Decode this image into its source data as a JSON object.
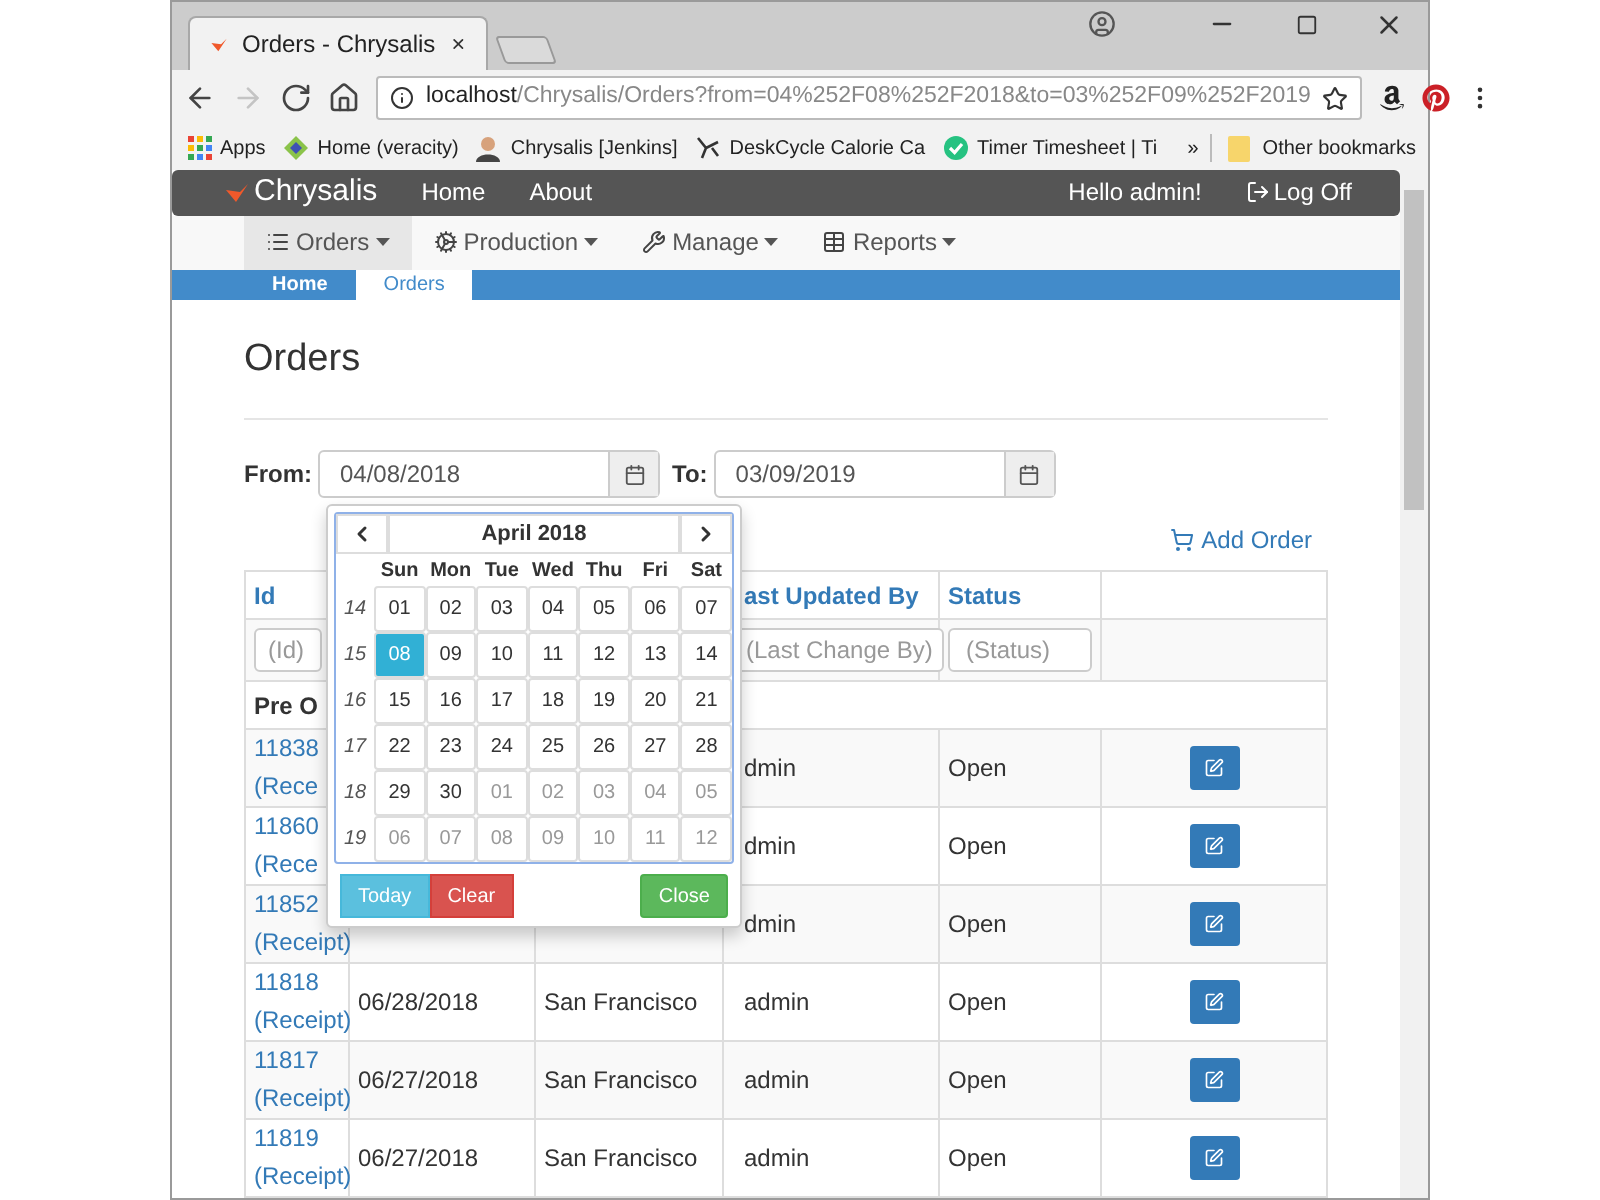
{
  "browser": {
    "tab": {
      "title": "Orders - Chrysalis"
    },
    "nav": [
      {
        "kind": "back",
        "disabled": false
      },
      {
        "kind": "forward",
        "disabled": true
      },
      {
        "kind": "reload",
        "disabled": false
      },
      {
        "kind": "home",
        "disabled": false
      }
    ],
    "url": {
      "host": "localhost",
      "path": "/Chrysalis/Orders?from=04%252F08%252F2018&to=03%252F09%252F2019"
    },
    "bookmarks": [
      {
        "kind": "apps",
        "label": "Apps"
      },
      {
        "kind": "veracity",
        "label": "Home (veracity)"
      },
      {
        "kind": "jenkins",
        "label": "Chrysalis [Jenkins]"
      },
      {
        "kind": "cycle",
        "label": "DeskCycle Calorie Ca"
      },
      {
        "kind": "timer",
        "label": "Timer Timesheet | Ti"
      }
    ],
    "overflow": "»",
    "other_bookmarks": "Other bookmarks"
  },
  "navbar": {
    "brand": "Chrysalis",
    "links": [
      "Home",
      "About"
    ],
    "greeting": "Hello admin!",
    "logoff": "Log Off"
  },
  "menu": [
    {
      "kind": "list",
      "label": "Orders",
      "selected": true
    },
    {
      "kind": "cogs",
      "label": "Production",
      "selected": false
    },
    {
      "kind": "wrench",
      "label": "Manage",
      "selected": false
    },
    {
      "kind": "table",
      "label": "Reports",
      "selected": false
    }
  ],
  "breadcrumb": [
    {
      "label": "Home",
      "selected": false
    },
    {
      "label": "Orders",
      "selected": true
    }
  ],
  "page_title": "Orders",
  "filters": {
    "from_label": "From:",
    "from_value": "04/08/2018",
    "to_label": "To:",
    "to_value": "03/09/2019"
  },
  "datepicker": {
    "month": "April 2018",
    "weekdays": [
      "Sun",
      "Mon",
      "Tue",
      "Wed",
      "Thu",
      "Fri",
      "Sat"
    ],
    "weeks": [
      {
        "number": "14",
        "days": [
          {
            "label": "01",
            "muted": false,
            "selected": false
          },
          {
            "label": "02",
            "muted": false,
            "selected": false
          },
          {
            "label": "03",
            "muted": false,
            "selected": false
          },
          {
            "label": "04",
            "muted": false,
            "selected": false
          },
          {
            "label": "05",
            "muted": false,
            "selected": false
          },
          {
            "label": "06",
            "muted": false,
            "selected": false
          },
          {
            "label": "07",
            "muted": false,
            "selected": false
          }
        ]
      },
      {
        "number": "15",
        "days": [
          {
            "label": "08",
            "muted": false,
            "selected": true
          },
          {
            "label": "09",
            "muted": false,
            "selected": false
          },
          {
            "label": "10",
            "muted": false,
            "selected": false
          },
          {
            "label": "11",
            "muted": false,
            "selected": false
          },
          {
            "label": "12",
            "muted": false,
            "selected": false
          },
          {
            "label": "13",
            "muted": false,
            "selected": false
          },
          {
            "label": "14",
            "muted": false,
            "selected": false
          }
        ]
      },
      {
        "number": "16",
        "days": [
          {
            "label": "15",
            "muted": false,
            "selected": false
          },
          {
            "label": "16",
            "muted": false,
            "selected": false
          },
          {
            "label": "17",
            "muted": false,
            "selected": false
          },
          {
            "label": "18",
            "muted": false,
            "selected": false
          },
          {
            "label": "19",
            "muted": false,
            "selected": false
          },
          {
            "label": "20",
            "muted": false,
            "selected": false
          },
          {
            "label": "21",
            "muted": false,
            "selected": false
          }
        ]
      },
      {
        "number": "17",
        "days": [
          {
            "label": "22",
            "muted": false,
            "selected": false
          },
          {
            "label": "23",
            "muted": false,
            "selected": false
          },
          {
            "label": "24",
            "muted": false,
            "selected": false
          },
          {
            "label": "25",
            "muted": false,
            "selected": false
          },
          {
            "label": "26",
            "muted": false,
            "selected": false
          },
          {
            "label": "27",
            "muted": false,
            "selected": false
          },
          {
            "label": "28",
            "muted": false,
            "selected": false
          }
        ]
      },
      {
        "number": "18",
        "days": [
          {
            "label": "29",
            "muted": false,
            "selected": false
          },
          {
            "label": "30",
            "muted": false,
            "selected": false
          },
          {
            "label": "01",
            "muted": true,
            "selected": false
          },
          {
            "label": "02",
            "muted": true,
            "selected": false
          },
          {
            "label": "03",
            "muted": true,
            "selected": false
          },
          {
            "label": "04",
            "muted": true,
            "selected": false
          },
          {
            "label": "05",
            "muted": true,
            "selected": false
          }
        ]
      },
      {
        "number": "19",
        "days": [
          {
            "label": "06",
            "muted": true,
            "selected": false
          },
          {
            "label": "07",
            "muted": true,
            "selected": false
          },
          {
            "label": "08",
            "muted": true,
            "selected": false
          },
          {
            "label": "09",
            "muted": true,
            "selected": false
          },
          {
            "label": "10",
            "muted": true,
            "selected": false
          },
          {
            "label": "11",
            "muted": true,
            "selected": false
          },
          {
            "label": "12",
            "muted": true,
            "selected": false
          }
        ]
      }
    ],
    "buttons": [
      {
        "kind": "today",
        "label": "Today"
      },
      {
        "kind": "clear",
        "label": "Clear"
      },
      {
        "kind": "close",
        "label": "Close"
      }
    ]
  },
  "add_order": "Add Order",
  "table": {
    "header": {
      "id": "Id",
      "last_updated_by": "ast Updated By",
      "status": "Status"
    },
    "filters": {
      "id": {
        "placeholder": "(Id)"
      },
      "last_change_by": {
        "placeholder": "(Last Change By)"
      },
      "status": {
        "placeholder": "(Status)"
      }
    },
    "group": "Pre O",
    "rows": [
      {
        "id": "11838",
        "receipt": "(Rece",
        "updated_by": "dmin",
        "status": "Open"
      },
      {
        "id": "11860",
        "receipt": "(Rece",
        "updated_by": "dmin",
        "status": "Open"
      },
      {
        "id": "11852",
        "receipt": "(Receipt)",
        "updated_by": "dmin",
        "status": "Open"
      },
      {
        "id": "11818",
        "receipt": "(Receipt)",
        "date": "06/28/2018",
        "location": "San Francisco",
        "updated_by": "admin",
        "status": "Open"
      },
      {
        "id": "11817",
        "receipt": "(Receipt)",
        "date": "06/27/2018",
        "location": "San Francisco",
        "updated_by": "admin",
        "status": "Open"
      },
      {
        "id": "11819",
        "receipt": "(Receipt)",
        "date": "06/27/2018",
        "location": "San Francisco",
        "updated_by": "admin",
        "status": "Open"
      }
    ]
  }
}
